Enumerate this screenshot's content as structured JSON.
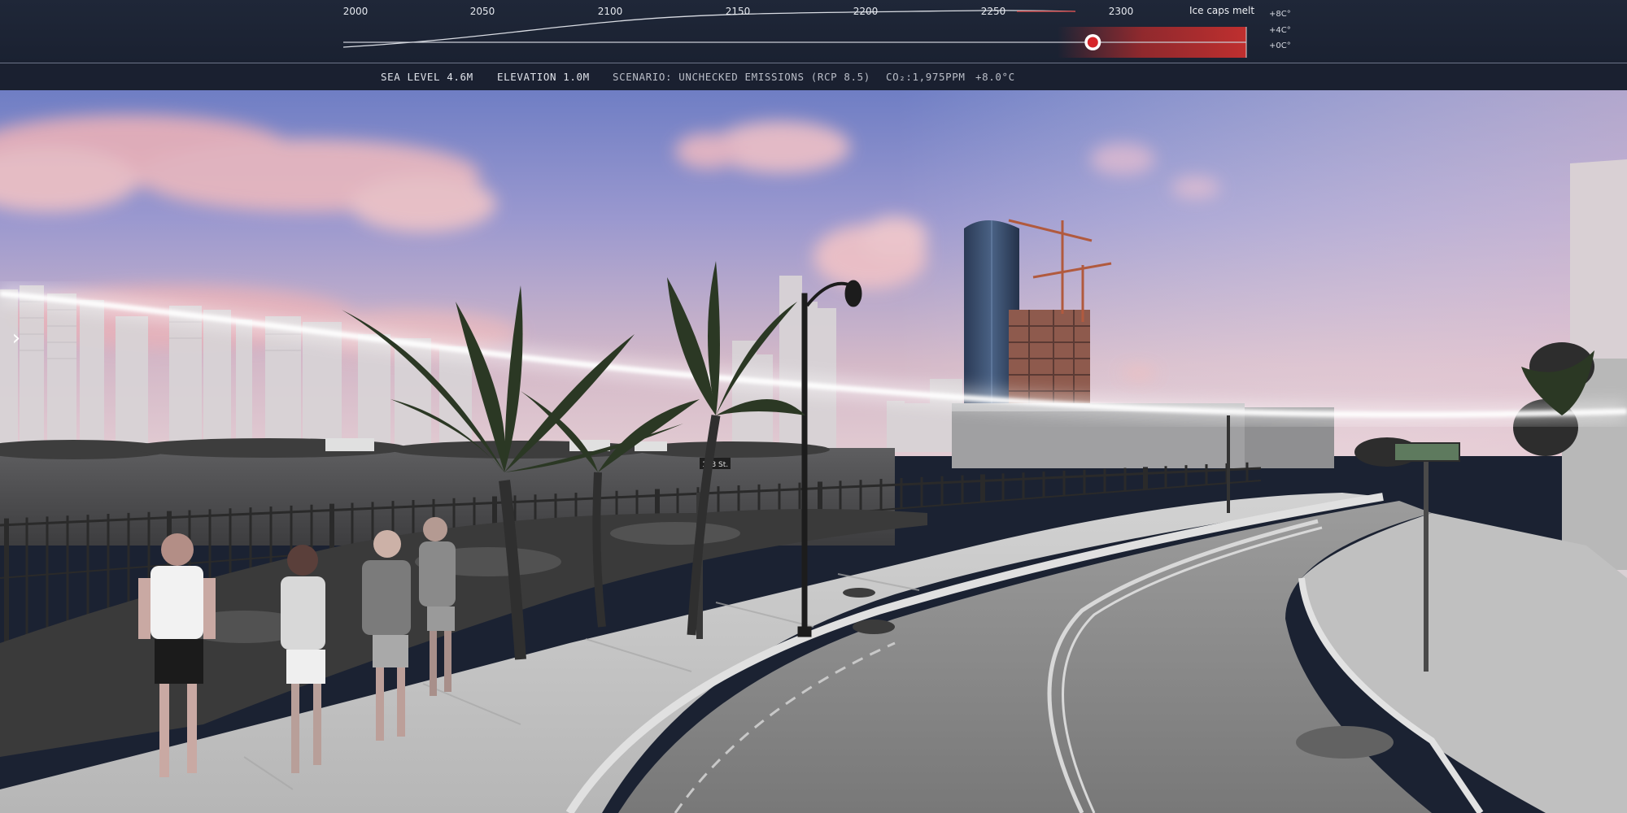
{
  "timeline": {
    "years": [
      "2000",
      "2050",
      "2100",
      "2150",
      "2200",
      "2250",
      "2300"
    ],
    "event_label": "Ice caps melt",
    "temperature_labels": [
      "+8C°",
      "+4C°",
      "+0C°"
    ],
    "current_year_fraction": 0.83,
    "colors": {
      "accent": "#d6252a",
      "track": "#c9ccd4",
      "warming": "#c42f2f"
    }
  },
  "status": {
    "sea_level": "SEA LEVEL 4.6M",
    "elevation": "ELEVATION 1.0M",
    "scenario": "SCENARIO: UNCHECKED EMISSIONS (RCP 8.5)",
    "co2": "CO₂:1,975PPM",
    "temperature": "+8.0°C"
  },
  "scene": {
    "nav_icon": "chevron-right-icon",
    "street_sign": "183 St."
  }
}
